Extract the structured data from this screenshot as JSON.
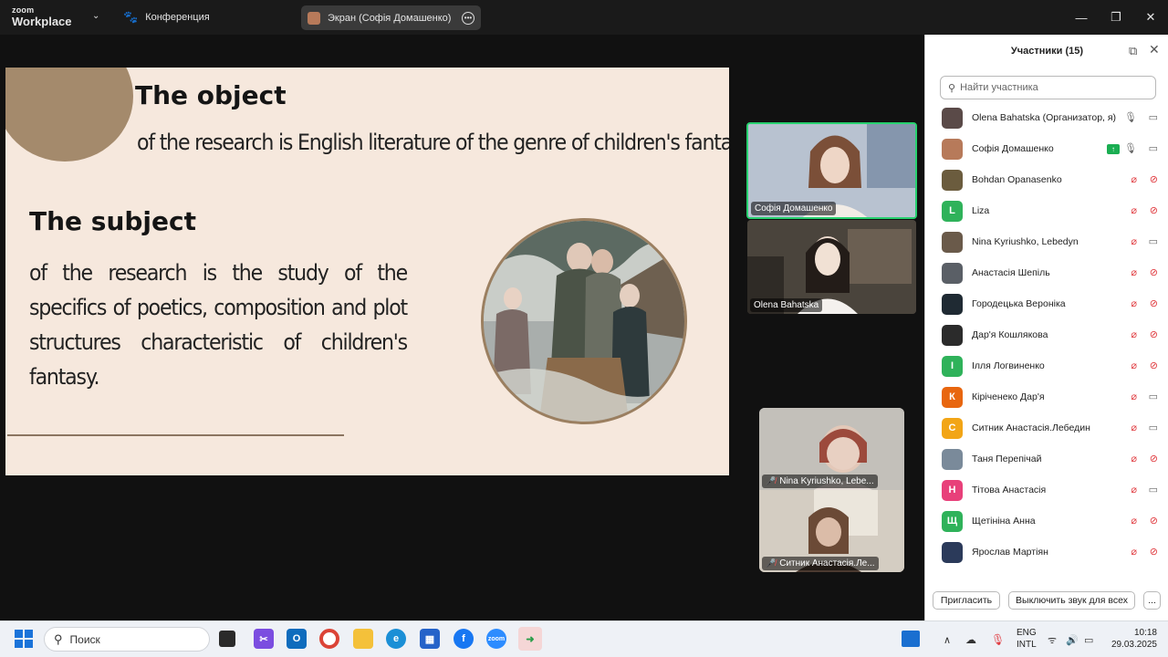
{
  "app": {
    "brand_top": "zoom",
    "brand_bottom": "Workplace",
    "conference_label": "Конференция",
    "screen_share_label": "Экран (Софія Домашенко)"
  },
  "slide": {
    "object_title": "The object",
    "object_text": "of the research is English literature of the genre of children's fantasy.",
    "subject_title": "The subject",
    "subject_text": "of the research is the study of the specifics of poetics, composition and plot structures characteristic of children's fantasy."
  },
  "video_tiles": [
    {
      "name": "Софія Домашенко",
      "muted": false
    },
    {
      "name": "Olena Bahatska",
      "muted": false
    },
    {
      "name": "Nina Kyriushko, Lebe...",
      "muted": true
    },
    {
      "name": "Ситник Анастасія.Ле...",
      "muted": true
    }
  ],
  "participants_panel": {
    "title": "Участники (15)",
    "search_placeholder": "Найти участника",
    "invite_label": "Пригласить",
    "mute_all_label": "Выключить звук для всех",
    "more_label": "...",
    "participants": [
      {
        "name": "Olena Bahatska (Организатор, я)",
        "initial": "",
        "color": "#5a4a48",
        "mic_muted": false,
        "cam_off": false,
        "sharing": false
      },
      {
        "name": "Софія Домашенко",
        "initial": "",
        "color": "#b77a5a",
        "mic_muted": false,
        "cam_off": false,
        "sharing": true
      },
      {
        "name": "Bohdan Opanasenko",
        "initial": "",
        "color": "#6b5c3e",
        "mic_muted": true,
        "cam_off": true,
        "sharing": false
      },
      {
        "name": "Liza",
        "initial": "L",
        "color": "#2fb25a",
        "mic_muted": true,
        "cam_off": true,
        "sharing": false
      },
      {
        "name": "Nina Kyriushko, Lebedyn",
        "initial": "",
        "color": "#6a5a4a",
        "mic_muted": true,
        "cam_off": false,
        "sharing": false
      },
      {
        "name": "Анастасія Шепіль",
        "initial": "",
        "color": "#5a5f66",
        "mic_muted": true,
        "cam_off": true,
        "sharing": false
      },
      {
        "name": "Городецька Вероніка",
        "initial": "",
        "color": "#1f2a33",
        "mic_muted": true,
        "cam_off": true,
        "sharing": false
      },
      {
        "name": "Дар'я Кошлякова",
        "initial": "",
        "color": "#2b2b2b",
        "mic_muted": true,
        "cam_off": true,
        "sharing": false
      },
      {
        "name": "Ілля Логвиненко",
        "initial": "І",
        "color": "#2fb25a",
        "mic_muted": true,
        "cam_off": true,
        "sharing": false
      },
      {
        "name": "Кіріченеко Дар'я",
        "initial": "К",
        "color": "#e8660f",
        "mic_muted": true,
        "cam_off": false,
        "sharing": false
      },
      {
        "name": "Ситник Анастасія.Лебедин",
        "initial": "С",
        "color": "#f2a516",
        "mic_muted": true,
        "cam_off": false,
        "sharing": false
      },
      {
        "name": "Таня Перепічай",
        "initial": "",
        "color": "#7a8a9a",
        "mic_muted": true,
        "cam_off": true,
        "sharing": false
      },
      {
        "name": "Тітова Анастасія",
        "initial": "Н",
        "color": "#e8407a",
        "mic_muted": true,
        "cam_off": false,
        "sharing": false
      },
      {
        "name": "Щетініна Анна",
        "initial": "Щ",
        "color": "#2fb25a",
        "mic_muted": true,
        "cam_off": true,
        "sharing": false
      },
      {
        "name": "Ярослав Мартіян",
        "initial": "",
        "color": "#2b3a5a",
        "mic_muted": true,
        "cam_off": true,
        "sharing": false
      }
    ]
  },
  "taskbar": {
    "search_label": "Поиск",
    "lang_top": "ENG",
    "lang_bottom": "INTL",
    "time": "10:18",
    "date": "29.03.2025"
  }
}
